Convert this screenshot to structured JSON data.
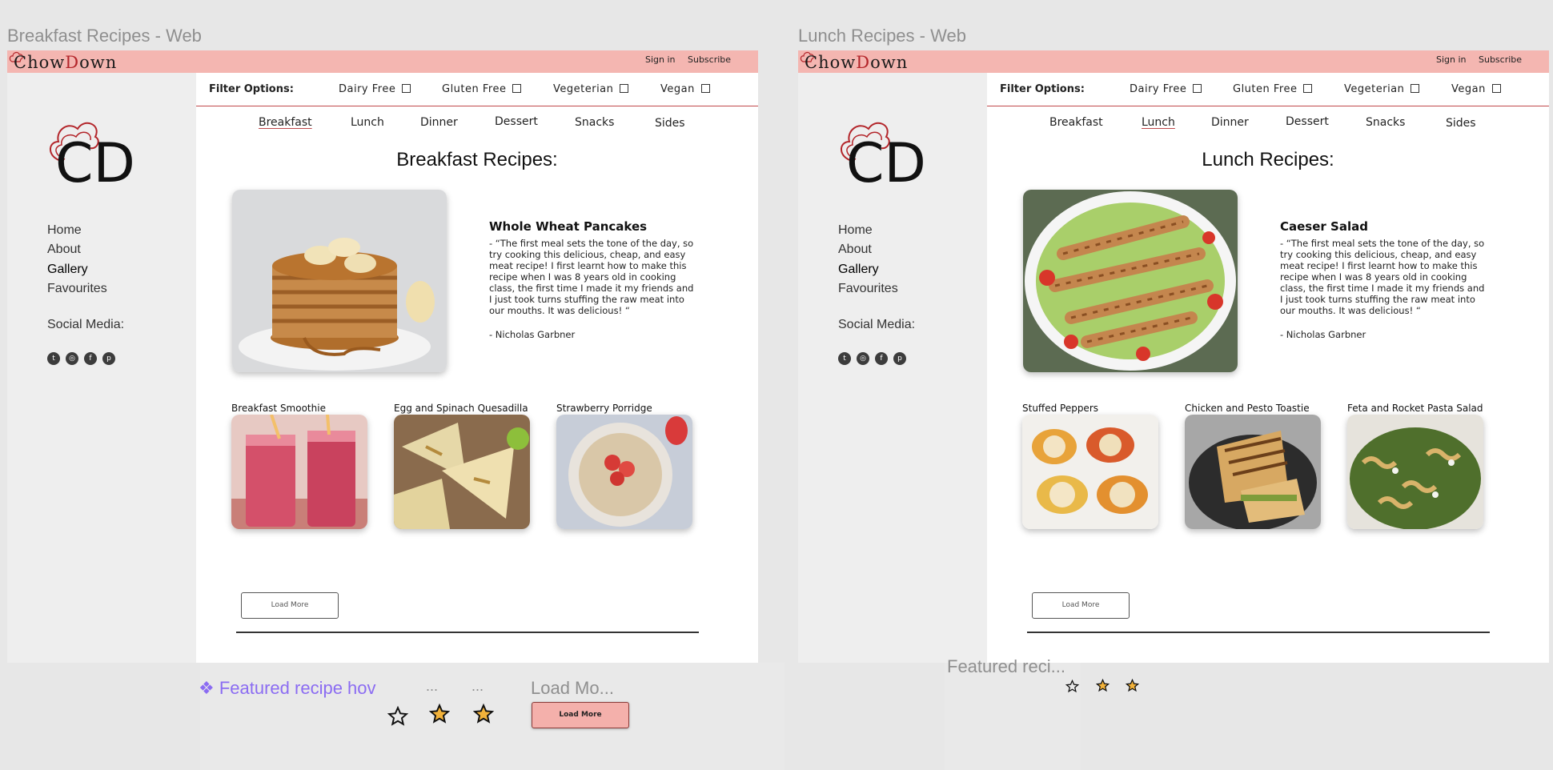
{
  "frames": [
    {
      "title": "Breakfast Recipes - Web",
      "brand": {
        "left": "Chow",
        "o": "D",
        "right": "wn"
      },
      "brand_full": "ChowDown",
      "sign_in": "Sign in",
      "subscribe": "Subscribe",
      "logo_initials": "CD",
      "nav": [
        "Home",
        "About",
        "Gallery",
        "Favourites"
      ],
      "social_label": "Social Media:",
      "social_icons": [
        "twitter-icon",
        "instagram-icon",
        "facebook-icon",
        "pinterest-icon"
      ],
      "filter_label": "Filter Options:",
      "filters": [
        "Dairy Free",
        "Gluten Free",
        "Vegeterian",
        "Vegan"
      ],
      "tabs": [
        "Breakfast",
        "Lunch",
        "Dinner",
        "Dessert",
        "Snacks",
        "Sides"
      ],
      "active_tab": "Breakfast",
      "heading": "Breakfast Recipes:",
      "featured": {
        "title": "Whole Wheat Pancakes",
        "description": "-  “The first meal sets the tone of the day, so try cooking this delicious, cheap, and easy meat recipe! I first learnt how to make this recipe when I was 8 years old in cooking class, the first time I made it my friends and I just took turns stuffing the raw meat into our mouths. It was delicious! “",
        "author": "- Nicholas Garbner"
      },
      "cards": [
        "Breakfast Smoothie",
        "Egg and Spinach Quesadilla",
        "Strawberry Porridge"
      ],
      "load_more": "Load More"
    },
    {
      "title": "Lunch Recipes - Web",
      "brand": {
        "left": "Chow",
        "o": "D",
        "right": "wn"
      },
      "brand_full": "ChowDown",
      "sign_in": "Sign in",
      "subscribe": "Subscribe",
      "logo_initials": "CD",
      "nav": [
        "Home",
        "About",
        "Gallery",
        "Favourites"
      ],
      "social_label": "Social Media:",
      "social_icons": [
        "twitter-icon",
        "instagram-icon",
        "facebook-icon",
        "pinterest-icon"
      ],
      "filter_label": "Filter Options:",
      "filters": [
        "Dairy Free",
        "Gluten Free",
        "Vegeterian",
        "Vegan"
      ],
      "tabs": [
        "Breakfast",
        "Lunch",
        "Dinner",
        "Dessert",
        "Snacks",
        "Sides"
      ],
      "active_tab": "Lunch",
      "heading": "Lunch Recipes:",
      "featured": {
        "title": "Caeser Salad",
        "description": "-  “The first meal sets the tone of the day, so try cooking this delicious, cheap, and easy meat recipe! I first learnt how to make this recipe when I was 8 years old in cooking class, the first time I made it my friends and I just took turns stuffing the raw meat into our mouths. It was delicious! “",
        "author": "- Nicholas Garbner"
      },
      "cards": [
        "Stuffed Peppers",
        "Chicken and Pesto Toastie",
        "Feta and Rocket Pasta Salad"
      ],
      "load_more": "Load More"
    }
  ],
  "components": {
    "featured_hover_label": "Featured recipe hov",
    "ellipsis_1": "...",
    "ellipsis_2": "...",
    "load_more_label": "Load Mo...",
    "load_more_hover_button": "Load More",
    "featured_right_label": "Featured reci..."
  },
  "colors": {
    "topbar": "#f4b6b1",
    "accent_red": "#c0494b",
    "star_fill": "#f2b23a",
    "component_purple": "#8b6cf2"
  }
}
